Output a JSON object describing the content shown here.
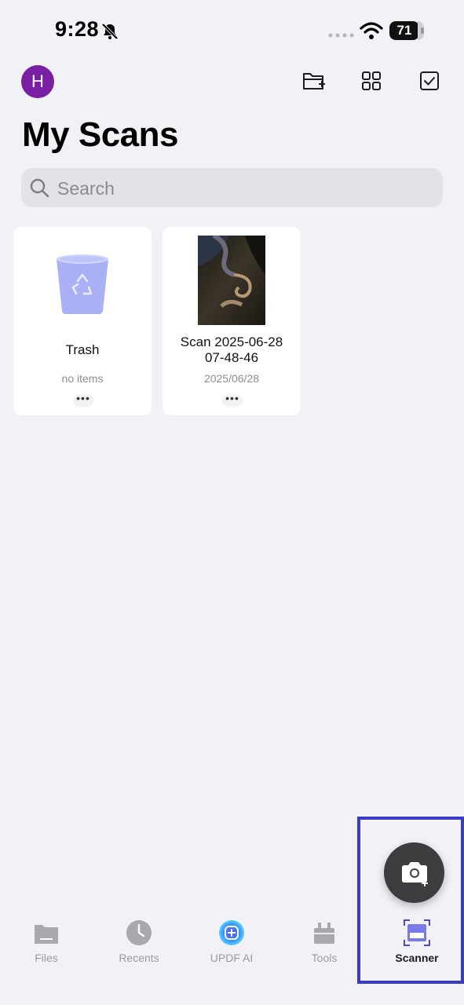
{
  "status_bar": {
    "time": "9:28",
    "battery": "71"
  },
  "header": {
    "avatar_initial": "H",
    "title": "My Scans"
  },
  "search": {
    "placeholder": "Search"
  },
  "items": [
    {
      "name": "Trash",
      "subtitle": "no items"
    },
    {
      "name_line1": "Scan 2025-06-28",
      "name_line2": "07-48-46",
      "subtitle": "2025/06/28"
    }
  ],
  "more_label": "•••",
  "tabs": [
    {
      "label": "Files"
    },
    {
      "label": "Recents"
    },
    {
      "label": "UPDF AI"
    },
    {
      "label": "Tools"
    },
    {
      "label": "Scanner"
    }
  ],
  "colors": {
    "avatar": "#7a1fa3",
    "accent": "#4a4ad6",
    "background": "#f2f1f6",
    "highlight": "#3a3acb"
  }
}
